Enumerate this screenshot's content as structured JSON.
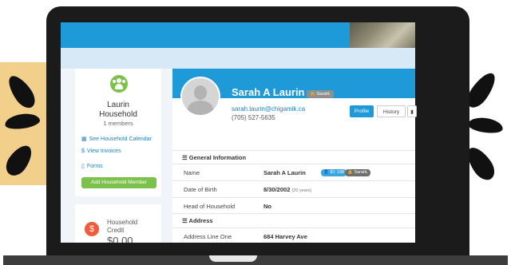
{
  "household": {
    "name_line1": "Laurin",
    "name_line2": "Household",
    "member_count": "1 members",
    "links": [
      {
        "icon": "calendar-icon",
        "glyph": "▦",
        "label": "See Household Calendar"
      },
      {
        "icon": "dollar-icon",
        "glyph": "$",
        "label": "View Invoices"
      },
      {
        "icon": "document-icon",
        "glyph": "▯",
        "label": "Forms"
      }
    ],
    "add_member_label": "Add Household Member"
  },
  "credit": {
    "label_line1": "Household",
    "label_line2": "Credit",
    "value": "$0.00",
    "icon_glyph": "$"
  },
  "profile": {
    "name": "Sarah A Laurin",
    "username_tag": "🔒 SarahL",
    "email": "sarah.laurin@chigamik.ca",
    "phone": "(705) 527-5635",
    "tabs": {
      "profile": "Profile",
      "history": "History",
      "more": "▮"
    }
  },
  "general_info": {
    "heading": "☰ General Information",
    "rows": [
      {
        "label": "Name",
        "value": "Sarah A Laurin",
        "badge_id": "👤 ID: 198",
        "badge_user": "🔒 SarahL"
      },
      {
        "label": "Date of Birth",
        "value": "8/30/2002",
        "note": "(20 years)"
      },
      {
        "label": "Head of Household",
        "value": "No"
      }
    ]
  },
  "address": {
    "heading": "☰ Address",
    "rows": [
      {
        "label": "Address Line One",
        "value": "684 Harvey Ave"
      }
    ]
  },
  "colors": {
    "primary_blue": "#1f9ad9",
    "green": "#7cc24a",
    "credit_orange": "#f15a3a",
    "decor_yellow": "#f2cf8a"
  }
}
